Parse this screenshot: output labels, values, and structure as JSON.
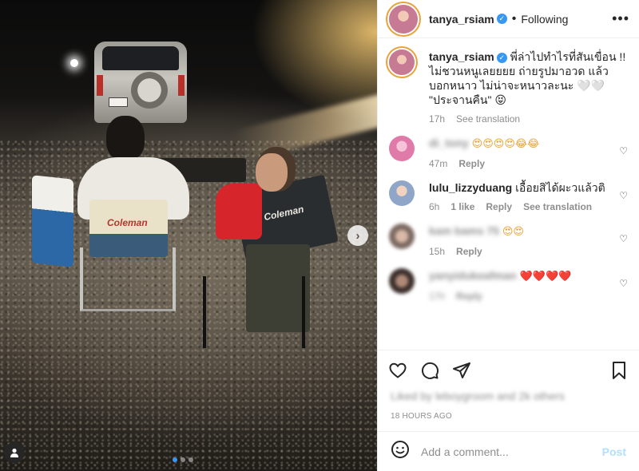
{
  "header": {
    "username": "tanya_rsiam",
    "dot": "•",
    "follow_label": "Following",
    "more_label": "•••"
  },
  "caption": {
    "username": "tanya_rsiam",
    "text": "พี่ล่าไปทำไรที่สันเขื่อน !! ไม่ชวนหนูเลยยยย ถ่ายรูปมาอวด แล้วบอกหนาว ไม่น่าจะหนาวละนะ 🤍🤍 \"ประจานคืน\" 😝",
    "time": "17h",
    "see_translation": "See translation"
  },
  "comments": [
    {
      "username": "di_tony",
      "text": "😍😍😍😍😂😂",
      "time": "47m",
      "reply": "Reply"
    },
    {
      "username": "lulu_lizzyduang",
      "text": "เอื้อยสิได้ผะวแล้วติ",
      "time": "6h",
      "likes": "1 like",
      "reply": "Reply",
      "see_translation": "See translation"
    },
    {
      "username": "kam bams 75",
      "text": "😍😍",
      "time": "15h",
      "reply": "Reply"
    },
    {
      "username": "yanyidukeafman",
      "text": "❤️❤️❤️❤️",
      "time": "17h",
      "reply": "Reply"
    }
  ],
  "likes_line": "Liked by leboygroom and 2k others",
  "timestamp": "18 HOURS AGO",
  "add_comment": {
    "placeholder": "Add a comment...",
    "post_label": "Post"
  },
  "photo": {
    "chair_brand_1": "Coleman",
    "chair_brand_2": "Coleman"
  },
  "colors": {
    "verified": "#3897f0",
    "post_disabled": "#b2dffc",
    "story_ring": "#e8a33c"
  },
  "icons": [
    "heart-icon",
    "comment-icon",
    "share-icon",
    "bookmark-icon",
    "emoji-icon",
    "tag-icon",
    "chevron-right-icon",
    "more-icon",
    "verified-icon"
  ]
}
